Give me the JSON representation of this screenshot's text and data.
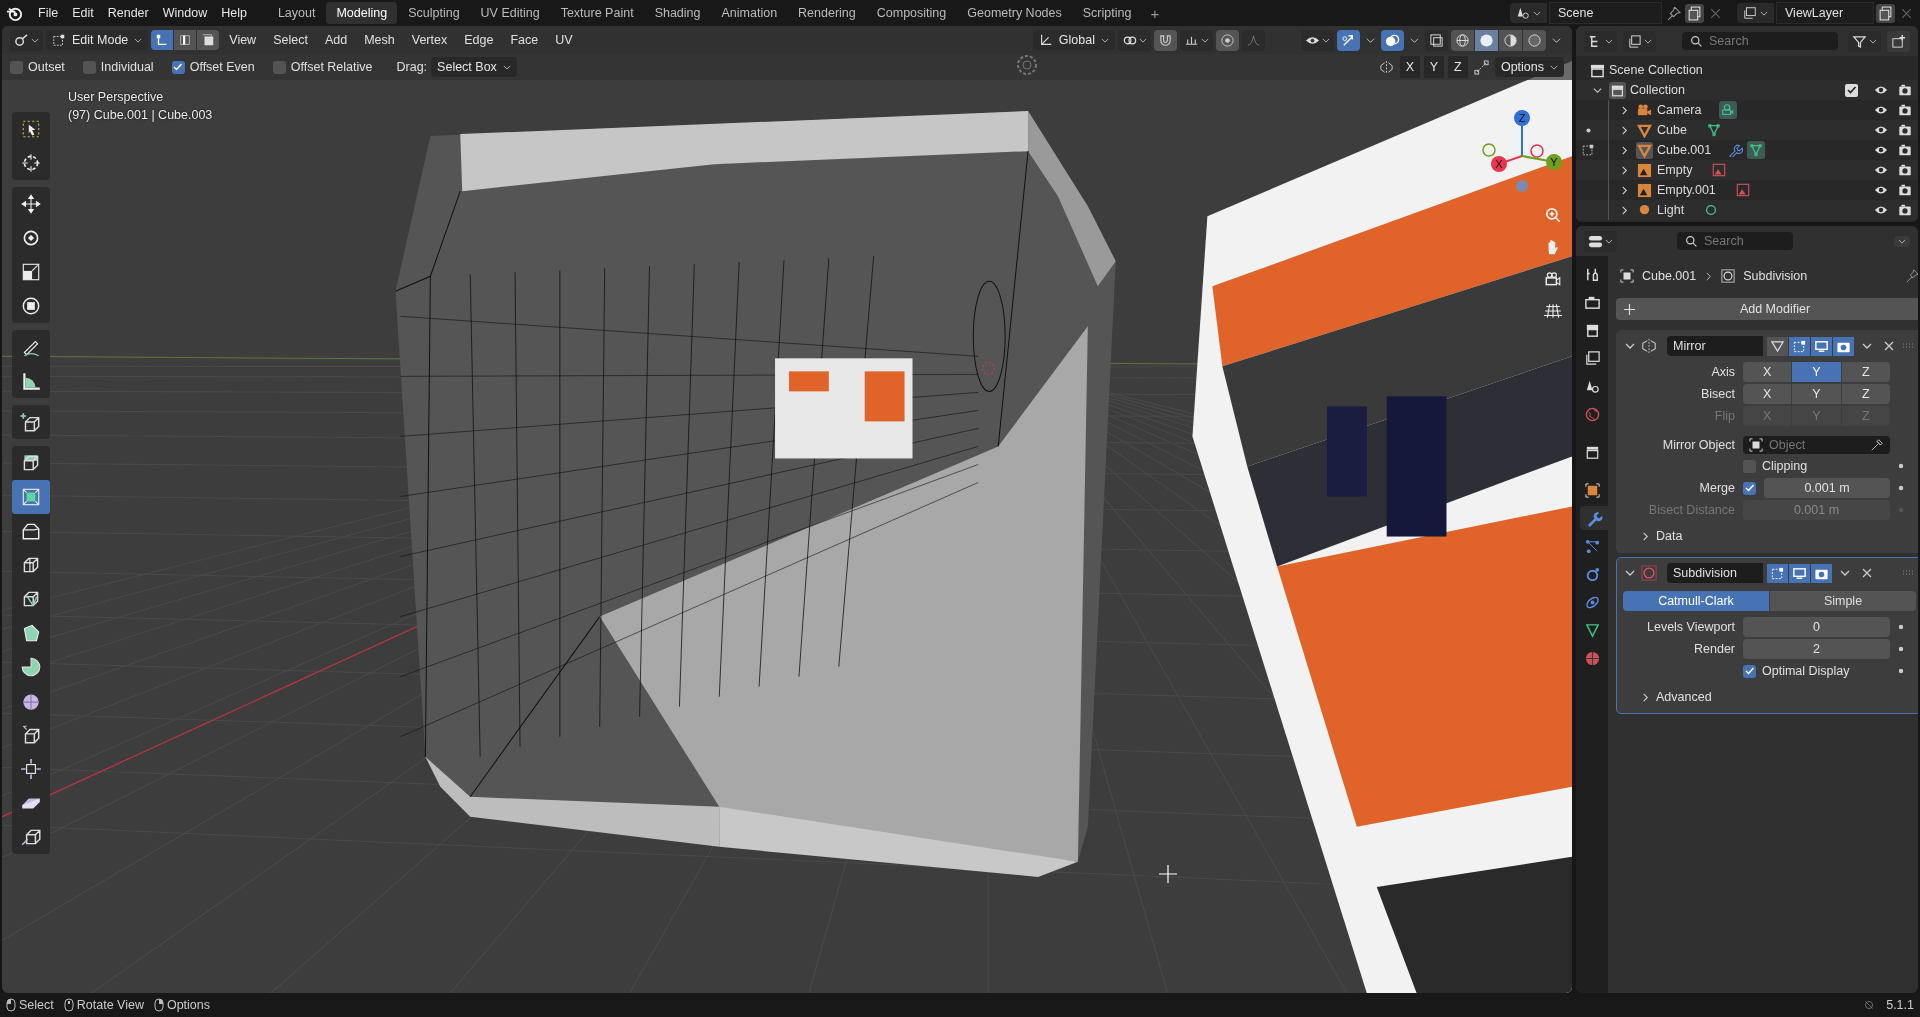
{
  "menu": [
    "File",
    "Edit",
    "Render",
    "Window",
    "Help"
  ],
  "workspaces": [
    {
      "label": "Layout",
      "selected": false
    },
    {
      "label": "Modeling",
      "selected": true
    },
    {
      "label": "Sculpting",
      "selected": false
    },
    {
      "label": "UV Editing",
      "selected": false
    },
    {
      "label": "Texture Paint",
      "selected": false
    },
    {
      "label": "Shading",
      "selected": false
    },
    {
      "label": "Animation",
      "selected": false
    },
    {
      "label": "Rendering",
      "selected": false
    },
    {
      "label": "Compositing",
      "selected": false
    },
    {
      "label": "Geometry Nodes",
      "selected": false
    },
    {
      "label": "Scripting",
      "selected": false
    }
  ],
  "add_workspace": "+",
  "scene": "Scene",
  "view_layer": "ViewLayer",
  "viewport_header": {
    "mode": "Edit Mode",
    "select_modes": [
      {
        "kind": "vertex",
        "selected": true
      },
      {
        "kind": "edge",
        "selected": false
      },
      {
        "kind": "face",
        "selected": false
      }
    ],
    "menus": [
      "View",
      "Select",
      "Add",
      "Mesh",
      "Vertex",
      "Edge",
      "Face",
      "UV"
    ],
    "orientation": "Global",
    "toggles": [
      {
        "kind": "gizmo",
        "on": true
      },
      {
        "kind": "overlay",
        "on": true
      },
      {
        "kind": "xray",
        "on": false
      }
    ],
    "shading": [
      {
        "kind": "wireframe",
        "selected": false
      },
      {
        "kind": "solid",
        "selected": true
      },
      {
        "kind": "material",
        "selected": false
      },
      {
        "kind": "rendered",
        "selected": false
      }
    ]
  },
  "tool_settings": {
    "checks": [
      {
        "label": "Outset",
        "checked": false
      },
      {
        "label": "Individual",
        "checked": false
      },
      {
        "label": "Offset Even",
        "checked": true
      },
      {
        "label": "Offset Relative",
        "checked": false
      }
    ],
    "drag_label": "Drag:",
    "drag_value": "Select Box"
  },
  "mirror_axes": [
    {
      "label": "X",
      "selected": false
    },
    {
      "label": "Y",
      "selected": false
    },
    {
      "label": "Z",
      "selected": false
    }
  ],
  "options": "Options",
  "viewport_info": [
    "User Perspective",
    "(97) Cube.001 | Cube.003"
  ],
  "toolbar": [
    {
      "tools": [
        {
          "kind": "select",
          "selected": false
        },
        {
          "kind": "cursor",
          "selected": false
        }
      ]
    },
    {
      "tools": [
        {
          "kind": "move",
          "selected": false
        },
        {
          "kind": "rotate",
          "selected": false
        },
        {
          "kind": "scale",
          "selected": false
        },
        {
          "kind": "transform",
          "selected": false
        }
      ]
    },
    {
      "tools": [
        {
          "kind": "annotate",
          "selected": false
        },
        {
          "kind": "measure",
          "selected": false
        }
      ]
    },
    {
      "tools": [
        {
          "kind": "add-cube",
          "selected": false
        }
      ]
    },
    {
      "tools": [
        {
          "kind": "extrude",
          "selected": false
        },
        {
          "kind": "inset",
          "selected": true
        },
        {
          "kind": "bevel",
          "selected": false
        },
        {
          "kind": "loop-cut",
          "selected": false
        },
        {
          "kind": "knife",
          "selected": false
        },
        {
          "kind": "poly-build",
          "selected": false
        },
        {
          "kind": "spin",
          "selected": false
        },
        {
          "kind": "smooth",
          "selected": false
        },
        {
          "kind": "edge-slide",
          "selected": false
        },
        {
          "kind": "shrink",
          "selected": false
        },
        {
          "kind": "shear",
          "selected": false
        },
        {
          "kind": "rip",
          "selected": false
        }
      ]
    }
  ],
  "gizmo_axes": [
    {
      "label": "Z",
      "color": "#2f6fd6"
    },
    {
      "label": "X",
      "color": "#e8344f"
    },
    {
      "label": "Y",
      "color": "#6ea01e"
    }
  ],
  "outliner": {
    "search_placeholder": "Search",
    "root": "Scene Collection",
    "collection": {
      "label": "Collection",
      "expanded": true,
      "checked": true,
      "children": [
        {
          "label": "Camera",
          "kind": "camera",
          "editable": false,
          "edit_mode": false,
          "modifiers": false,
          "data_active": true,
          "selected": false
        },
        {
          "label": "Cube",
          "kind": "mesh",
          "editable": true,
          "edit_mode": false,
          "modifiers": false,
          "data_active": false,
          "selected": false
        },
        {
          "label": "Cube.001",
          "kind": "mesh",
          "editable": true,
          "edit_mode": true,
          "modifiers": true,
          "data_active": true,
          "selected": true
        },
        {
          "label": "Empty",
          "kind": "empty",
          "editable": false,
          "edit_mode": false,
          "modifiers": false,
          "data_active": false,
          "selected": false
        },
        {
          "label": "Empty.001",
          "kind": "empty",
          "editable": false,
          "edit_mode": false,
          "modifiers": false,
          "data_active": false,
          "selected": false
        },
        {
          "label": "Light",
          "kind": "light",
          "editable": false,
          "edit_mode": false,
          "modifiers": false,
          "data_active": false,
          "selected": false
        }
      ]
    }
  },
  "properties": {
    "search_placeholder": "Search",
    "tabs": [
      {
        "kind": "tool",
        "selected": false
      },
      {
        "kind": "render",
        "selected": false
      },
      {
        "kind": "output",
        "selected": false
      },
      {
        "kind": "view-layer",
        "selected": false
      },
      {
        "kind": "scene",
        "selected": false
      },
      {
        "kind": "world",
        "selected": false
      },
      {
        "kind": "collection",
        "selected": false
      },
      {
        "kind": "object",
        "selected": false
      },
      {
        "kind": "modifiers",
        "selected": true
      },
      {
        "kind": "particles",
        "selected": false
      },
      {
        "kind": "physics",
        "selected": false
      },
      {
        "kind": "constraints",
        "selected": false
      },
      {
        "kind": "data",
        "selected": false
      },
      {
        "kind": "material",
        "selected": false
      }
    ],
    "breadcrumb": [
      "Cube.001",
      "Subdivision"
    ],
    "add_modifier": "Add Modifier",
    "mirror": {
      "name": "Mirror",
      "expanded": true,
      "active": false,
      "axis_label": "Axis",
      "axis": [
        {
          "label": "X",
          "selected": false
        },
        {
          "label": "Y",
          "selected": true
        },
        {
          "label": "Z",
          "selected": false
        }
      ],
      "bisect_label": "Bisect",
      "bisect": [
        {
          "label": "X",
          "selected": false
        },
        {
          "label": "Y",
          "selected": false
        },
        {
          "label": "Z",
          "selected": false
        }
      ],
      "flip_label": "Flip",
      "flip": [
        {
          "label": "X",
          "selected": false
        },
        {
          "label": "Y",
          "selected": false
        },
        {
          "label": "Z",
          "selected": false
        }
      ],
      "flip_disabled": true,
      "mirror_object_label": "Mirror Object",
      "mirror_object_placeholder": "Object",
      "clipping": {
        "label": "Clipping",
        "checked": false
      },
      "merge": {
        "label": "Merge",
        "checked": true,
        "value": "0.001 m"
      },
      "bisect_distance": {
        "label": "Bisect Distance",
        "value": "0.001 m",
        "disabled": true
      },
      "data": {
        "label": "Data",
        "expanded": false
      }
    },
    "subdivision": {
      "name": "Subdivision",
      "expanded": true,
      "active": true,
      "methods": [
        {
          "label": "Catmull-Clark",
          "selected": true
        },
        {
          "label": "Simple",
          "selected": false
        }
      ],
      "levels_viewport": {
        "label": "Levels Viewport",
        "value": "0"
      },
      "render": {
        "label": "Render",
        "value": "2"
      },
      "optimal_display": {
        "label": "Optimal Display",
        "checked": true
      },
      "advanced": {
        "label": "Advanced",
        "expanded": false
      }
    }
  },
  "status_bar": {
    "hints": [
      {
        "kind": "left",
        "label": "Select"
      },
      {
        "kind": "middle",
        "label": "Rotate View"
      },
      {
        "kind": "right",
        "label": "Options"
      }
    ],
    "version": "5.1.1"
  }
}
